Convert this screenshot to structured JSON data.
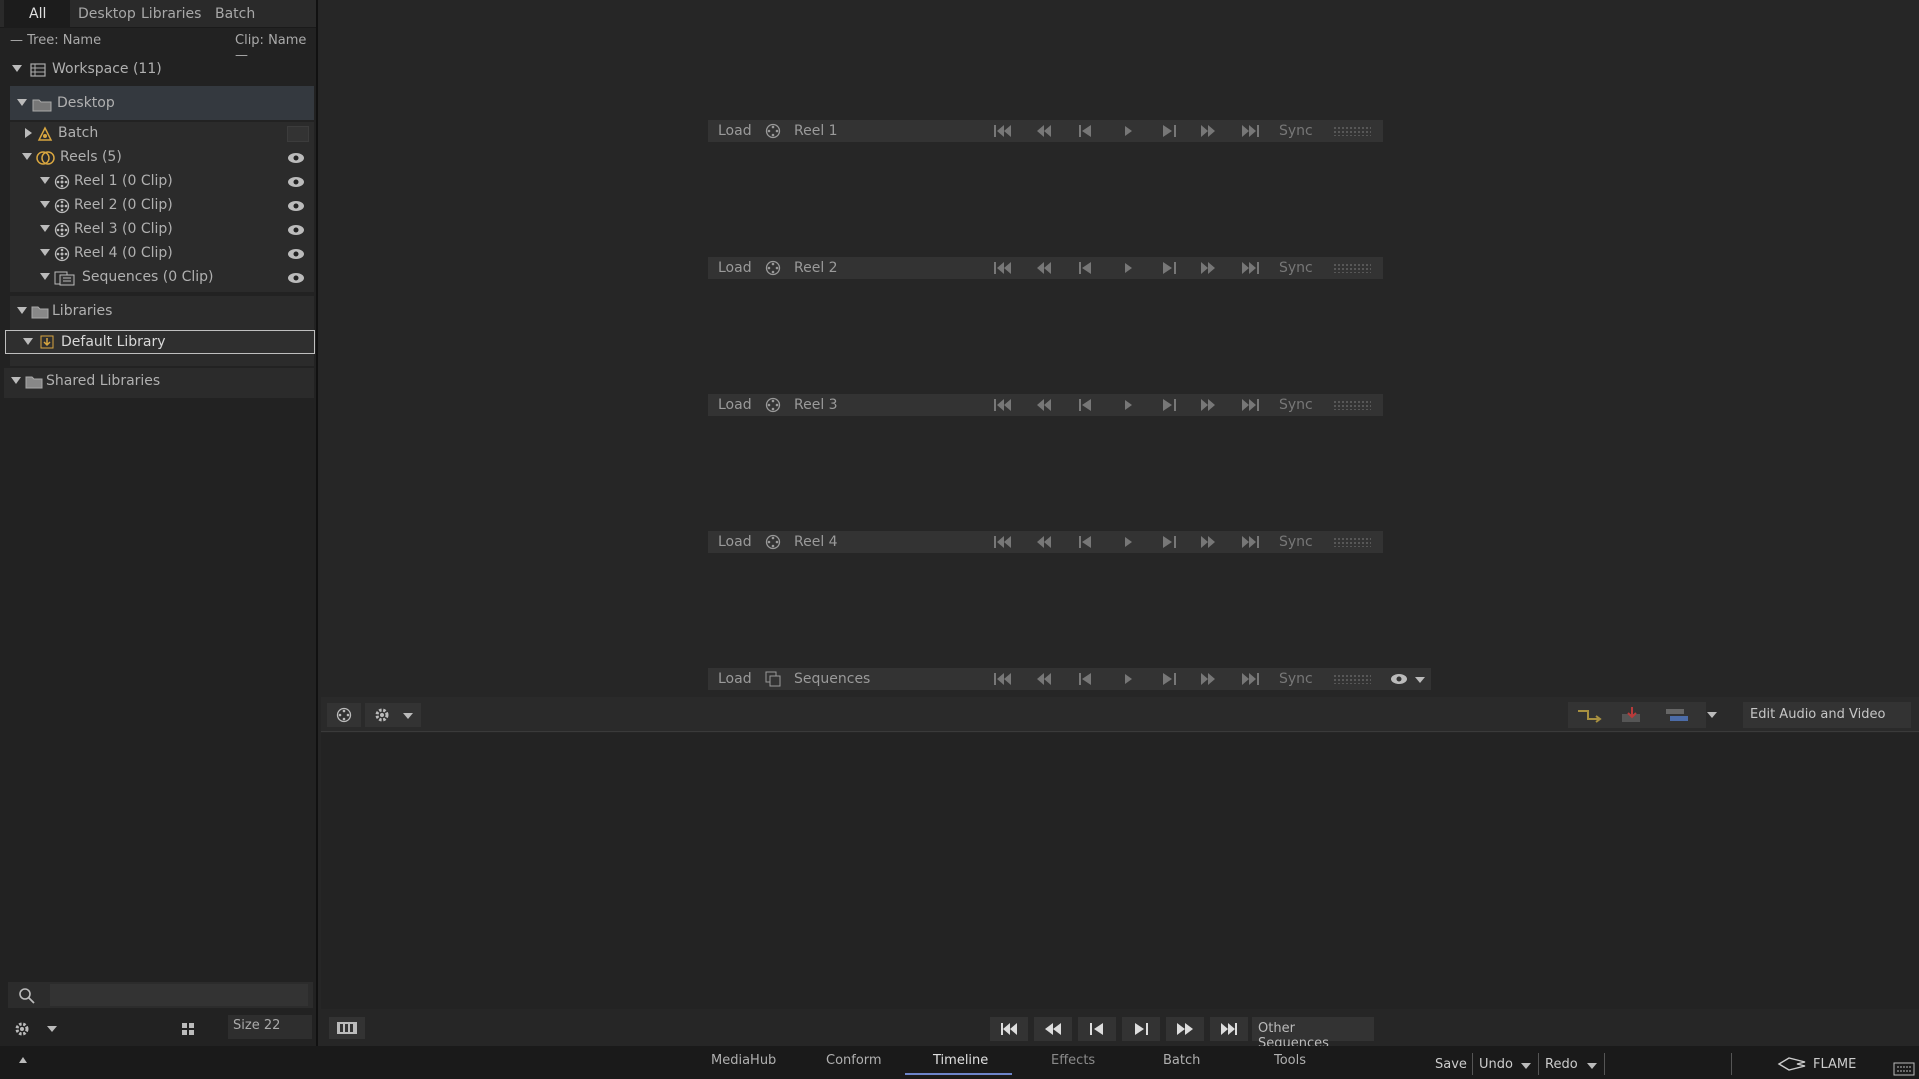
{
  "left_panel": {
    "tabs": [
      "All",
      "Desktop",
      "Libraries",
      "Batch"
    ],
    "sort_left": "— Tree: Name",
    "sort_right": "Clip: Name —",
    "workspace": "Workspace (11)",
    "desktop": "Desktop",
    "batch": "Batch",
    "reels_group": "Reels (5)",
    "reel_items": [
      "Reel 1 (0 Clip)",
      "Reel 2 (0 Clip)",
      "Reel 3 (0 Clip)",
      "Reel 4 (0 Clip)",
      "Sequences (0 Clip)"
    ],
    "libraries": "Libraries",
    "default_library": "Default Library",
    "shared_libraries": "Shared Libraries",
    "size_label": "Size 22"
  },
  "reels": [
    {
      "load": "Load",
      "name": "Reel 1",
      "sync": "Sync"
    },
    {
      "load": "Load",
      "name": "Reel 2",
      "sync": "Sync"
    },
    {
      "load": "Load",
      "name": "Reel 3",
      "sync": "Sync"
    },
    {
      "load": "Load",
      "name": "Reel 4",
      "sync": "Sync"
    },
    {
      "load": "Load",
      "name": "Sequences",
      "sync": "Sync"
    }
  ],
  "toolbar": {
    "edit_mode": "Edit Audio and Video",
    "other_sequences": "Other Sequences"
  },
  "bottom_tabs": [
    "MediaHub",
    "Conform",
    "Timeline",
    "Effects",
    "Batch",
    "Tools"
  ],
  "bottom_right": {
    "save": "Save",
    "undo": "Undo",
    "redo": "Redo",
    "brand": "FLAME"
  },
  "colors": {
    "accent": "#6d84c9",
    "reel_bar": "#333333",
    "background": "#262626"
  }
}
